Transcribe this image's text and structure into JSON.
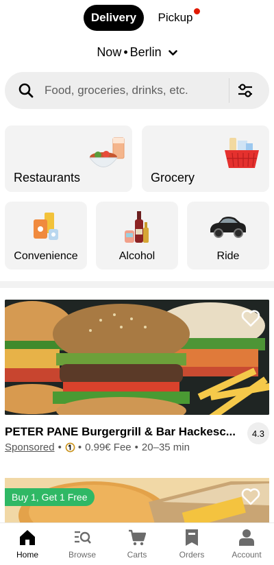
{
  "mode_toggle": {
    "delivery_label": "Delivery",
    "pickup_label": "Pickup"
  },
  "location": {
    "time": "Now",
    "separator": "•",
    "city": "Berlin"
  },
  "search": {
    "placeholder": "Food, groceries, drinks, etc."
  },
  "categories": [
    {
      "label": "Restaurants",
      "icon": "restaurant-bowl-icon"
    },
    {
      "label": "Grocery",
      "icon": "grocery-basket-icon"
    },
    {
      "label": "Convenience",
      "icon": "convenience-bags-icon"
    },
    {
      "label": "Alcohol",
      "icon": "alcohol-bottles-icon"
    },
    {
      "label": "Ride",
      "icon": "car-icon"
    }
  ],
  "stores": [
    {
      "name": "PETER PANE Burgergrill & Bar Hackesc...",
      "rating": "4.3",
      "sponsored_label": "Sponsored",
      "fee": "0.99€ Fee",
      "eta": "20–35 min"
    },
    {
      "promo": "Buy 1, Get 1 Free"
    }
  ],
  "bottom_nav": [
    {
      "label": "Home",
      "icon": "home-icon",
      "active": true
    },
    {
      "label": "Browse",
      "icon": "browse-icon"
    },
    {
      "label": "Carts",
      "icon": "cart-icon"
    },
    {
      "label": "Orders",
      "icon": "orders-icon"
    },
    {
      "label": "Account",
      "icon": "account-icon"
    }
  ],
  "colors": {
    "accent": "#000000",
    "notification_dot": "#e11900",
    "promo_green": "#2fb865",
    "surface": "#f3f3f3"
  }
}
